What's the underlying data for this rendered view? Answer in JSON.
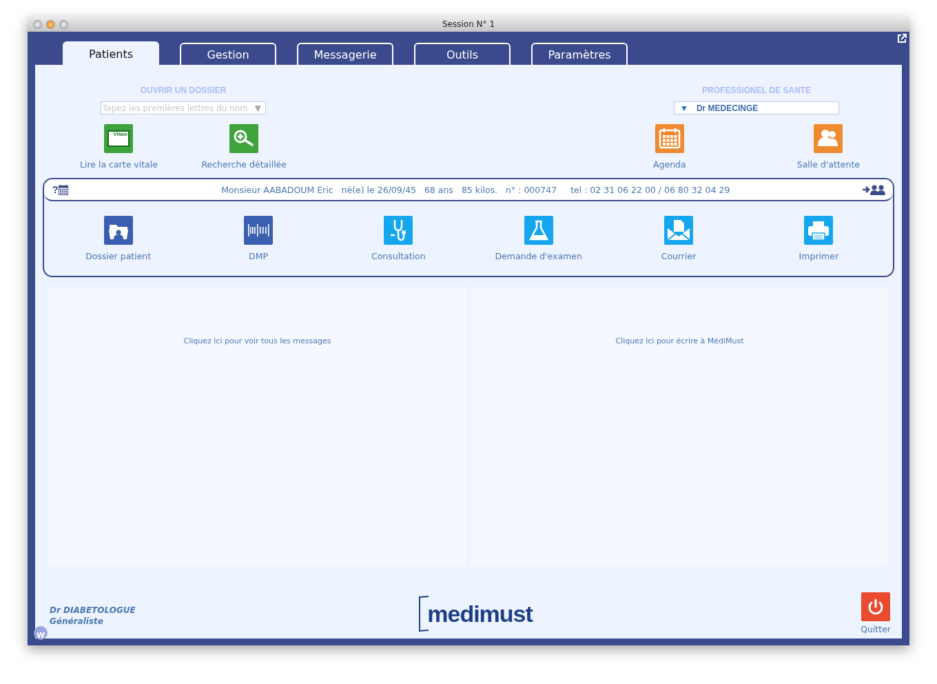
{
  "window": {
    "title": "Session N° 1"
  },
  "tabs": [
    {
      "label": "Patients",
      "selected": true
    },
    {
      "label": "Gestion",
      "selected": false
    },
    {
      "label": "Messagerie",
      "selected": false
    },
    {
      "label": "Outils",
      "selected": false
    },
    {
      "label": "Paramètres",
      "selected": false
    }
  ],
  "open_file": {
    "heading": "OUVRIR UN DOSSIER",
    "search": {
      "placeholder": "Tapez les premières lettres du nom",
      "arrow": "▼"
    },
    "actions": [
      {
        "kind": "vitale",
        "label": "Lire la carte vitale",
        "icon_text": "Vitale"
      },
      {
        "kind": "search",
        "label": "Recherche détaillée"
      }
    ]
  },
  "professional": {
    "heading": "PROFESSIONEL DE SANTE",
    "select": {
      "arrow": "▼",
      "value": "Dr MEDECINGE"
    },
    "actions": [
      {
        "kind": "calendar",
        "label": "Agenda"
      },
      {
        "kind": "people",
        "label": "Salle d'attente"
      }
    ]
  },
  "patient": {
    "help": "?",
    "info": [
      "Monsieur AABADOUM Eric",
      "né(e) le 26/09/45",
      "68 ans",
      "85 kilos.",
      "n° : 000747",
      "tel : 02 31 06 22 00 / 06 80 32 04 29"
    ],
    "actions": [
      {
        "kind": "folder",
        "label": "Dossier patient"
      },
      {
        "kind": "dmp",
        "label": "DMP"
      },
      {
        "kind": "stethoscope",
        "label": "Consultation"
      },
      {
        "kind": "flask",
        "label": "Demande d'examen"
      },
      {
        "kind": "mail",
        "label": "Courrier"
      },
      {
        "kind": "printer",
        "label": "Imprimer"
      }
    ]
  },
  "panels": [
    {
      "text": "Cliquez ici pour voir tous les messages"
    },
    {
      "text": "Cliquez ici pour écrire à MédiMust"
    }
  ],
  "footer": {
    "user_name": "Dr DIABETOLOGUE",
    "user_role": "Généraliste",
    "badge": "W",
    "logo": "medimust",
    "quit": "Quitter"
  }
}
